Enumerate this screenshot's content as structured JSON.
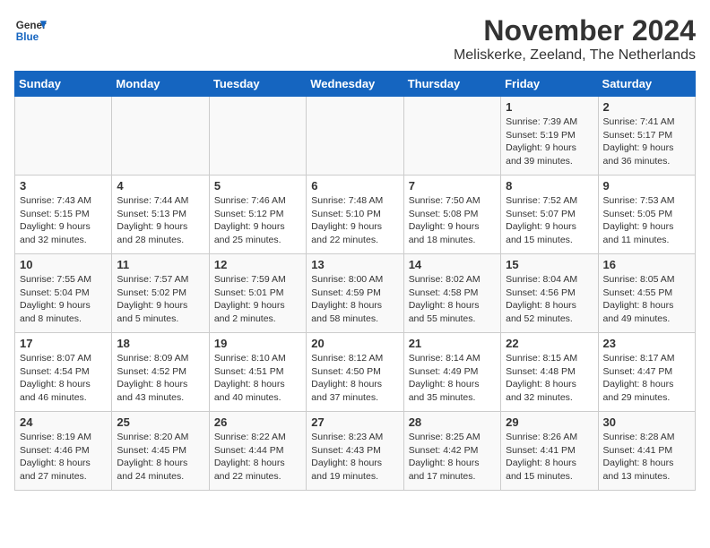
{
  "header": {
    "logo_line1": "General",
    "logo_line2": "Blue",
    "month_title": "November 2024",
    "location": "Meliskerke, Zeeland, The Netherlands"
  },
  "days_of_week": [
    "Sunday",
    "Monday",
    "Tuesday",
    "Wednesday",
    "Thursday",
    "Friday",
    "Saturday"
  ],
  "weeks": [
    [
      {
        "day": "",
        "info": ""
      },
      {
        "day": "",
        "info": ""
      },
      {
        "day": "",
        "info": ""
      },
      {
        "day": "",
        "info": ""
      },
      {
        "day": "",
        "info": ""
      },
      {
        "day": "1",
        "info": "Sunrise: 7:39 AM\nSunset: 5:19 PM\nDaylight: 9 hours and 39 minutes."
      },
      {
        "day": "2",
        "info": "Sunrise: 7:41 AM\nSunset: 5:17 PM\nDaylight: 9 hours and 36 minutes."
      }
    ],
    [
      {
        "day": "3",
        "info": "Sunrise: 7:43 AM\nSunset: 5:15 PM\nDaylight: 9 hours and 32 minutes."
      },
      {
        "day": "4",
        "info": "Sunrise: 7:44 AM\nSunset: 5:13 PM\nDaylight: 9 hours and 28 minutes."
      },
      {
        "day": "5",
        "info": "Sunrise: 7:46 AM\nSunset: 5:12 PM\nDaylight: 9 hours and 25 minutes."
      },
      {
        "day": "6",
        "info": "Sunrise: 7:48 AM\nSunset: 5:10 PM\nDaylight: 9 hours and 22 minutes."
      },
      {
        "day": "7",
        "info": "Sunrise: 7:50 AM\nSunset: 5:08 PM\nDaylight: 9 hours and 18 minutes."
      },
      {
        "day": "8",
        "info": "Sunrise: 7:52 AM\nSunset: 5:07 PM\nDaylight: 9 hours and 15 minutes."
      },
      {
        "day": "9",
        "info": "Sunrise: 7:53 AM\nSunset: 5:05 PM\nDaylight: 9 hours and 11 minutes."
      }
    ],
    [
      {
        "day": "10",
        "info": "Sunrise: 7:55 AM\nSunset: 5:04 PM\nDaylight: 9 hours and 8 minutes."
      },
      {
        "day": "11",
        "info": "Sunrise: 7:57 AM\nSunset: 5:02 PM\nDaylight: 9 hours and 5 minutes."
      },
      {
        "day": "12",
        "info": "Sunrise: 7:59 AM\nSunset: 5:01 PM\nDaylight: 9 hours and 2 minutes."
      },
      {
        "day": "13",
        "info": "Sunrise: 8:00 AM\nSunset: 4:59 PM\nDaylight: 8 hours and 58 minutes."
      },
      {
        "day": "14",
        "info": "Sunrise: 8:02 AM\nSunset: 4:58 PM\nDaylight: 8 hours and 55 minutes."
      },
      {
        "day": "15",
        "info": "Sunrise: 8:04 AM\nSunset: 4:56 PM\nDaylight: 8 hours and 52 minutes."
      },
      {
        "day": "16",
        "info": "Sunrise: 8:05 AM\nSunset: 4:55 PM\nDaylight: 8 hours and 49 minutes."
      }
    ],
    [
      {
        "day": "17",
        "info": "Sunrise: 8:07 AM\nSunset: 4:54 PM\nDaylight: 8 hours and 46 minutes."
      },
      {
        "day": "18",
        "info": "Sunrise: 8:09 AM\nSunset: 4:52 PM\nDaylight: 8 hours and 43 minutes."
      },
      {
        "day": "19",
        "info": "Sunrise: 8:10 AM\nSunset: 4:51 PM\nDaylight: 8 hours and 40 minutes."
      },
      {
        "day": "20",
        "info": "Sunrise: 8:12 AM\nSunset: 4:50 PM\nDaylight: 8 hours and 37 minutes."
      },
      {
        "day": "21",
        "info": "Sunrise: 8:14 AM\nSunset: 4:49 PM\nDaylight: 8 hours and 35 minutes."
      },
      {
        "day": "22",
        "info": "Sunrise: 8:15 AM\nSunset: 4:48 PM\nDaylight: 8 hours and 32 minutes."
      },
      {
        "day": "23",
        "info": "Sunrise: 8:17 AM\nSunset: 4:47 PM\nDaylight: 8 hours and 29 minutes."
      }
    ],
    [
      {
        "day": "24",
        "info": "Sunrise: 8:19 AM\nSunset: 4:46 PM\nDaylight: 8 hours and 27 minutes."
      },
      {
        "day": "25",
        "info": "Sunrise: 8:20 AM\nSunset: 4:45 PM\nDaylight: 8 hours and 24 minutes."
      },
      {
        "day": "26",
        "info": "Sunrise: 8:22 AM\nSunset: 4:44 PM\nDaylight: 8 hours and 22 minutes."
      },
      {
        "day": "27",
        "info": "Sunrise: 8:23 AM\nSunset: 4:43 PM\nDaylight: 8 hours and 19 minutes."
      },
      {
        "day": "28",
        "info": "Sunrise: 8:25 AM\nSunset: 4:42 PM\nDaylight: 8 hours and 17 minutes."
      },
      {
        "day": "29",
        "info": "Sunrise: 8:26 AM\nSunset: 4:41 PM\nDaylight: 8 hours and 15 minutes."
      },
      {
        "day": "30",
        "info": "Sunrise: 8:28 AM\nSunset: 4:41 PM\nDaylight: 8 hours and 13 minutes."
      }
    ]
  ]
}
